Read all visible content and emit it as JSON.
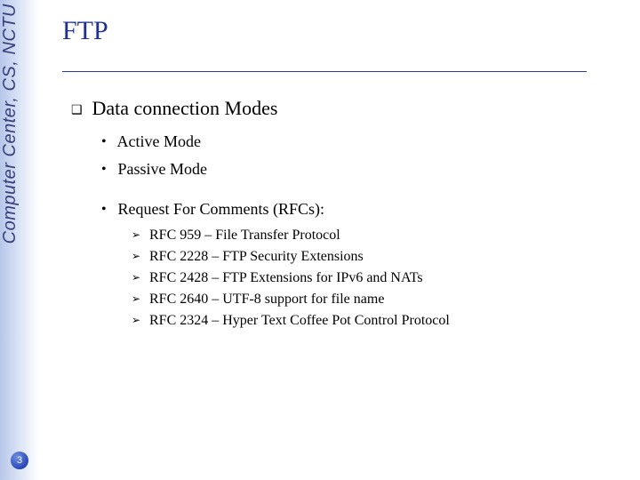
{
  "sidebar": {
    "org_text": "Computer Center, CS, NCTU",
    "page_number": "3"
  },
  "slide": {
    "title": "FTP",
    "heading": "Data connection Modes",
    "modes": [
      "Active Mode",
      "Passive Mode"
    ],
    "rfc_heading": "Request For Comments (RFCs):",
    "rfcs": [
      "RFC 959 – File Transfer Protocol",
      "RFC 2228 – FTP Security Extensions",
      "RFC 2428 – FTP Extensions for IPv6 and NATs",
      "RFC 2640 – UTF-8 support for file name",
      "RFC 2324 – Hyper Text Coffee Pot Control Protocol"
    ]
  }
}
